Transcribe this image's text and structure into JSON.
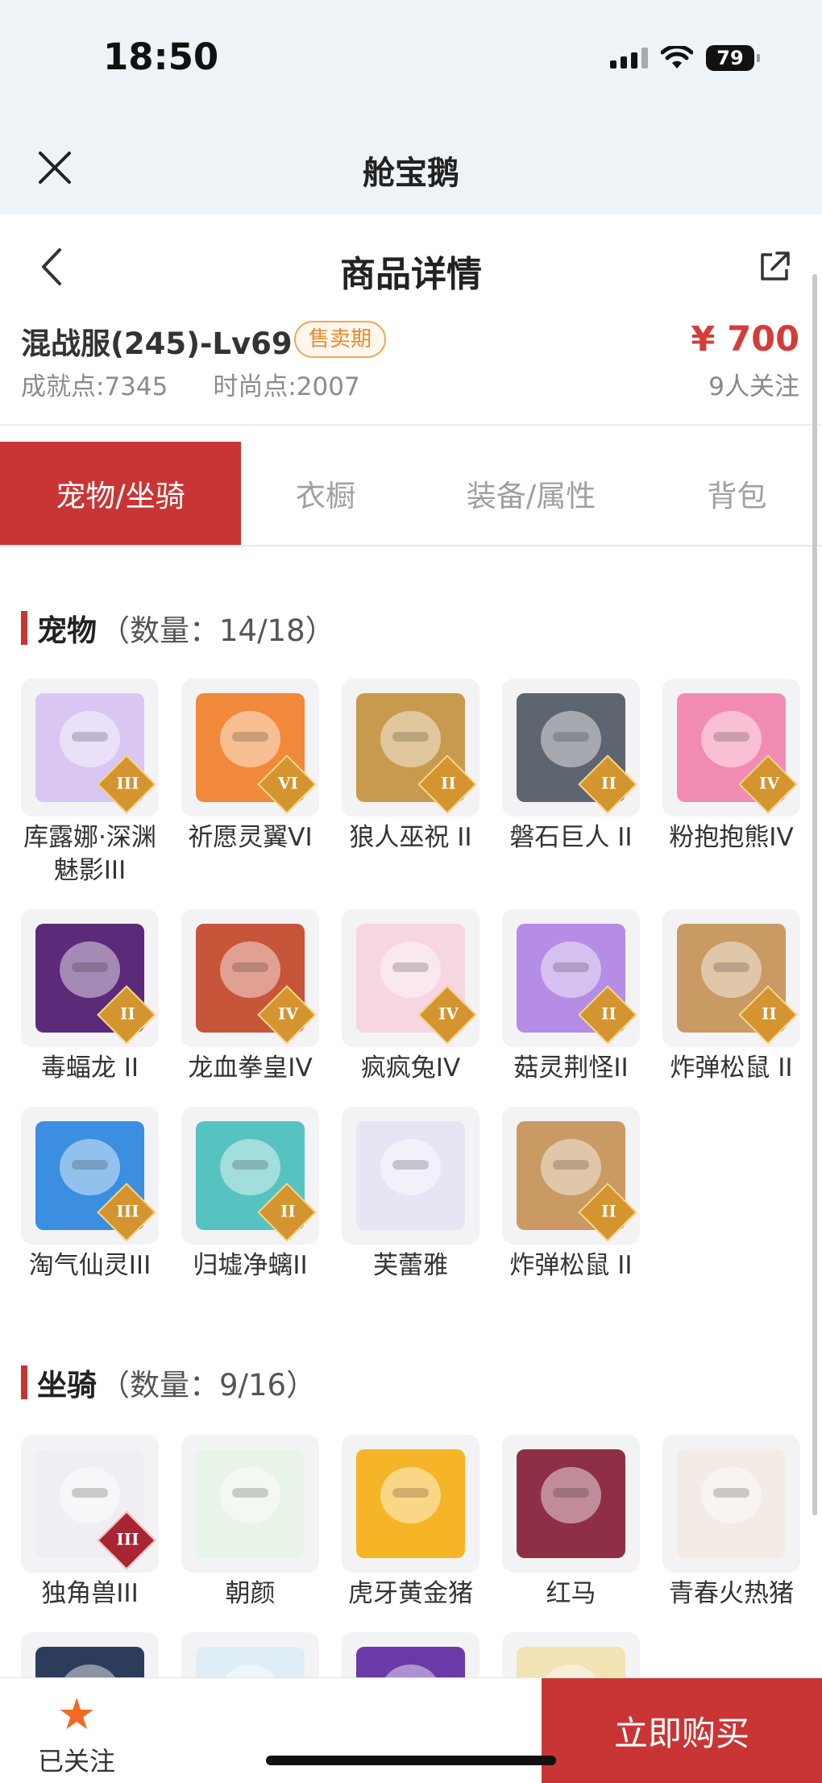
{
  "status": {
    "time": "18:50",
    "battery": "79"
  },
  "topbar": {
    "title": "舱宝鹅"
  },
  "nav": {
    "title": "商品详情"
  },
  "listing": {
    "server": "混战服(245)-Lv69",
    "badge": "售卖期",
    "achievement": "成就点:7345",
    "fashion": "时尚点:2007",
    "price": "¥ 700",
    "followers": "9人关注"
  },
  "tabs": [
    "宠物/坐骑",
    "衣橱",
    "装备/属性",
    "背包"
  ],
  "pets": {
    "title": "宠物",
    "count": "（数量：14/18）",
    "items": [
      {
        "label": "库露娜·深渊魅影III",
        "rank": "III",
        "color": "#d9c6f3"
      },
      {
        "label": "祈愿灵翼VI",
        "rank": "VI",
        "color": "#f08a3a"
      },
      {
        "label": "狼人巫祝 II",
        "rank": "II",
        "color": "#c89a4e"
      },
      {
        "label": "磐石巨人 II",
        "rank": "II",
        "color": "#5d6570"
      },
      {
        "label": "粉抱抱熊IV",
        "rank": "IV",
        "color": "#f28bb3"
      },
      {
        "label": "毒蝠龙 II",
        "rank": "II",
        "color": "#5b2a78"
      },
      {
        "label": "龙血拳皇IV",
        "rank": "IV",
        "color": "#c6553a"
      },
      {
        "label": "疯疯兔IV",
        "rank": "IV",
        "color": "#f6d6e2"
      },
      {
        "label": "菇灵荆怪II",
        "rank": "II",
        "color": "#b58ce6"
      },
      {
        "label": "炸弹松鼠 II",
        "rank": "II",
        "color": "#c99a63"
      },
      {
        "label": "淘气仙灵III",
        "rank": "III",
        "color": "#3b8ee0"
      },
      {
        "label": "归墟净螭II",
        "rank": "II",
        "color": "#57c3c0"
      },
      {
        "label": "芙蕾雅",
        "rank": "",
        "color": "#e8e4f4"
      },
      {
        "label": "炸弹松鼠 II",
        "rank": "II",
        "color": "#c99a63"
      }
    ]
  },
  "mounts": {
    "title": "坐骑",
    "count": "（数量：9/16）",
    "items": [
      {
        "label": "独角兽III",
        "rank": "III",
        "color": "#f0eef5",
        "red": true
      },
      {
        "label": "朝颜",
        "rank": "",
        "color": "#e9f4e8"
      },
      {
        "label": "虎牙黄金猪",
        "rank": "",
        "color": "#f6b526"
      },
      {
        "label": "红马",
        "rank": "",
        "color": "#8e2f45"
      },
      {
        "label": "青春火热猪",
        "rank": "",
        "color": "#f3ece6"
      },
      {
        "label": "",
        "rank": "",
        "color": "#2d3c5a"
      },
      {
        "label": "",
        "rank": "",
        "color": "#dfeef6"
      },
      {
        "label": "",
        "rank": "",
        "color": "#6a3aa8"
      },
      {
        "label": "",
        "rank": "",
        "color": "#f1e3b4"
      }
    ]
  },
  "bottom": {
    "follow_label": "已关注",
    "buy_label": "立即购买"
  }
}
